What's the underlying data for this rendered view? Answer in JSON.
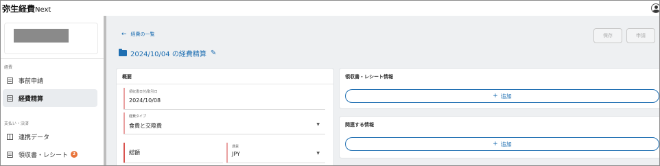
{
  "app": {
    "logo": "弥生経費",
    "logo_suffix": "Next"
  },
  "sidebar": {
    "section_expense": "経費",
    "items": [
      {
        "label": "事前申請",
        "icon": "document-icon",
        "active": false
      },
      {
        "label": "経費精算",
        "icon": "document-icon",
        "active": true
      }
    ],
    "section_payment": "支払い・決済",
    "items2": [
      {
        "label": "連携データ",
        "icon": "grid-icon"
      },
      {
        "label": "領収書・レシート",
        "icon": "receipt-icon",
        "badge": "2"
      }
    ]
  },
  "toolbar": {
    "back_label": "経費の一覧",
    "save_label": "保存",
    "apply_label": "申請"
  },
  "page": {
    "title": "2024/10/04 の経費精算"
  },
  "summary": {
    "title": "概要",
    "receipt_date_label": "領収書日付/取引日",
    "receipt_date_value": "2024/10/08",
    "expense_type_label": "経費タイプ",
    "expense_type_value": "食費と交際費",
    "amount_label": "総額",
    "currency_label": "通貨",
    "currency_value": "JPY"
  },
  "receipt_panel": {
    "title": "領収書・レシート情報",
    "add_label": "追加"
  },
  "related_panel": {
    "title": "関連する情報",
    "add_label": "追加"
  },
  "colors": {
    "accent": "#1f6fb2",
    "badge": "#e8743b",
    "required_bar": "#e9a0a0"
  }
}
